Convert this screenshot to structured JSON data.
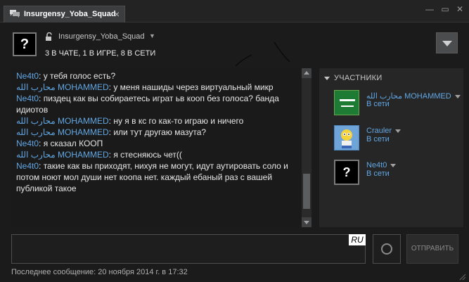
{
  "window": {
    "tab_title": "Insurgensy_Yoba_Squad",
    "tab_close": "×",
    "min_glyph": "—",
    "max_glyph": "▭",
    "close_glyph": "✕"
  },
  "group": {
    "avatar_glyph": "?",
    "name": "Insurgensy_Yoba_Squad",
    "dropdown_glyph": "▼",
    "status": "3 В ЧАТЕ, 1 В ИГРЕ, 8 В СЕТИ"
  },
  "messages": [
    {
      "sender": "Ne4t0",
      "text": ": у тебя голос есть?"
    },
    {
      "sender": "محارب الله MOHAMMED",
      "text": ": у меня нашиды через виртуальный микр"
    },
    {
      "sender": "Ne4t0",
      "text": ": пиздец как вы собираетесь играт ьв кооп без голоса? банда идиотов"
    },
    {
      "sender": "محارب الله MOHAMMED",
      "text": ": ну я в кс го как-то играю и ничего"
    },
    {
      "sender": "محارب الله MOHAMMED",
      "text": ": или тут другаю мазута?"
    },
    {
      "sender": "Ne4t0",
      "text": ": я сказал КООП"
    },
    {
      "sender": "محارب الله MOHAMMED",
      "text": ": я стесняюсь чет(("
    },
    {
      "sender": "Ne4t0",
      "text": ": такие как вы приходят, нихуя не могут, идут аутировать соло и потом ноют мол души нет коопа нет. каждый ебаный раз с вашей публикой такое"
    }
  ],
  "members": {
    "heading": "УЧАСТНИКИ",
    "items": [
      {
        "name": "محارب الله MOHAMMED",
        "status": "В сети",
        "avatar": "saudi-flag"
      },
      {
        "name": "Crauler",
        "status": "В сети",
        "avatar": "cartoon-character"
      },
      {
        "name": "Ne4t0",
        "status": "В сети",
        "avatar": "?"
      }
    ]
  },
  "composer": {
    "placeholder": "",
    "language_badge": "RU",
    "send_label": "ОТПРАВИТЬ"
  },
  "footer": {
    "last_message": "Последнее сообщение: 20 ноября 2014 г. в 17:32"
  },
  "colors": {
    "accent": "#62a7e3",
    "background": "#1b1b1c",
    "panel": "#262627"
  }
}
